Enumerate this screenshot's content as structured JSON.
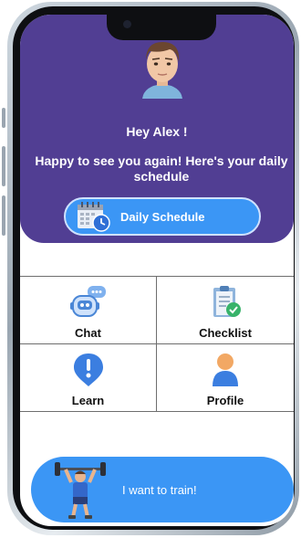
{
  "header": {
    "greeting": "Hey Alex  !",
    "subtitle": "Happy to see you again! Here's your daily schedule",
    "schedule_button": "Daily Schedule",
    "background_color": "#513e93"
  },
  "grid": [
    {
      "label": "Chat",
      "icon": "chat-bot-icon"
    },
    {
      "label": "Checklist",
      "icon": "checklist-icon"
    },
    {
      "label": "Learn",
      "icon": "exclamation-icon"
    },
    {
      "label": "Profile",
      "icon": "person-icon"
    }
  ],
  "train_button": {
    "label": "I want to train!",
    "icon": "weightlifter-icon"
  },
  "colors": {
    "accent": "#3b96f5"
  }
}
